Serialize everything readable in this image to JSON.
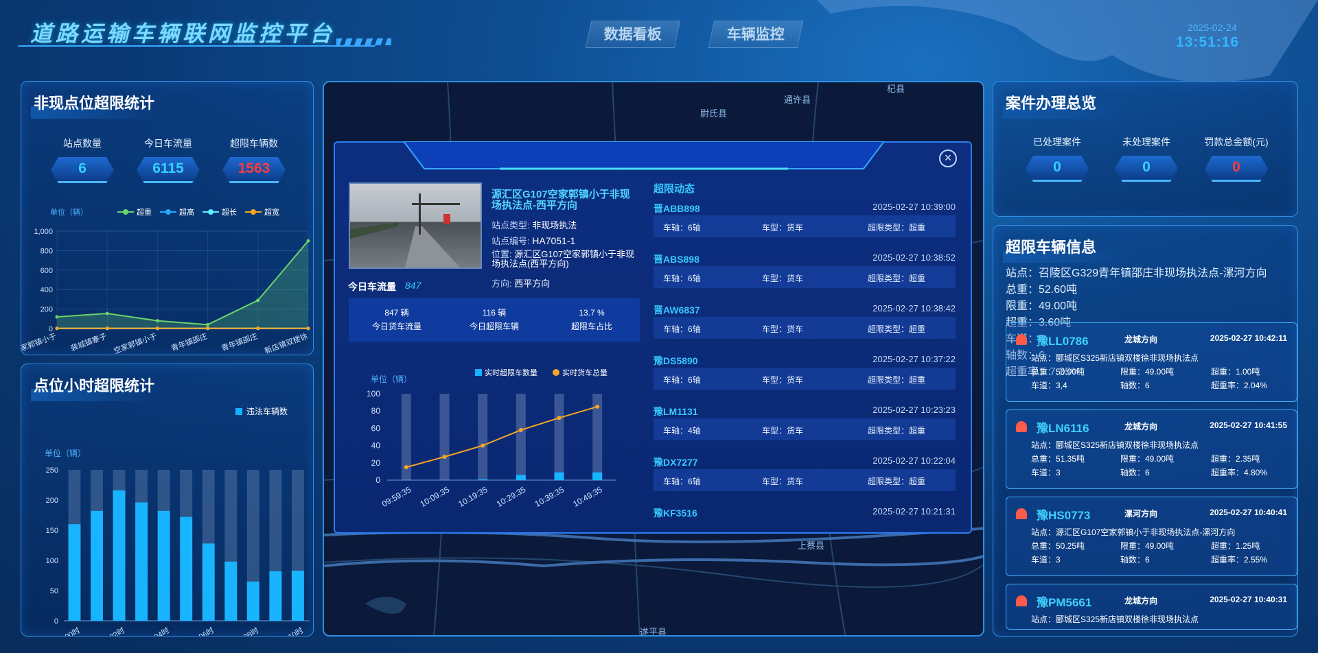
{
  "header": {
    "title": "道路运输车辆联网监控平台",
    "nav": [
      "数据看板",
      "车辆监控"
    ],
    "date": "2025-02-24",
    "time": "13:51:16"
  },
  "left_top": {
    "title": "非现点位超限统计",
    "stats": [
      {
        "label": "站点数量",
        "value": "6"
      },
      {
        "label": "今日车流量",
        "value": "6115"
      },
      {
        "label": "超限车辆数",
        "value": "1563"
      }
    ],
    "chart_data": {
      "type": "line",
      "unit": "单位（辆）",
      "categories": [
        "空家郭镇小于",
        "裴城镇寨子",
        "空家郭镇小于",
        "青年镇邵庄",
        "青年镇邵庄",
        "新店镇双楼徐"
      ],
      "ylim": [
        0,
        1000
      ],
      "yticks": [
        "1,000",
        "800",
        "600",
        "400",
        "200",
        "0"
      ],
      "series": [
        {
          "name": "超重",
          "color": "#6bd46b",
          "values": [
            120,
            155,
            80,
            40,
            290,
            900
          ]
        },
        {
          "name": "超高",
          "color": "#26a7ff",
          "values": [
            2,
            2,
            2,
            2,
            2,
            2
          ]
        },
        {
          "name": "超长",
          "color": "#5ff0ff",
          "values": [
            1,
            1,
            1,
            1,
            1,
            1
          ]
        },
        {
          "name": "超宽",
          "color": "#f5a623",
          "values": [
            3,
            3,
            3,
            3,
            3,
            3
          ]
        }
      ]
    }
  },
  "left_bottom": {
    "title": "点位小时超限统计",
    "chart_data": {
      "type": "bar",
      "unit": "单位（辆）",
      "legend": "违法车辆数",
      "ylim": [
        0,
        250
      ],
      "yticks": [
        "250",
        "200",
        "150",
        "100",
        "50",
        "0"
      ],
      "categories": [
        "00时",
        "01时",
        "02时",
        "03时",
        "04时",
        "05时",
        "06时",
        "07时",
        "08时",
        "09时",
        "10时"
      ],
      "xticks_shown": [
        "00时",
        "02时",
        "04时",
        "06时",
        "08时",
        "10时"
      ],
      "values": [
        160,
        182,
        216,
        196,
        182,
        172,
        128,
        98,
        65,
        82,
        83
      ]
    }
  },
  "popup": {
    "close": "×",
    "site_name": "源汇区G107空家郭镇小于非现场执法点-西平方向",
    "site_type_label": "站点类型:",
    "site_type": "非现场执法",
    "site_code_label": "站点编号:",
    "site_code": "HA7051-1",
    "location_label": "位置:",
    "location": "源汇区G107空家郭镇小于非现场执法点(西平方向)",
    "direction_label": "方向:",
    "direction": "西平方向",
    "flow_label": "今日车流量",
    "flow_value": "847",
    "summary": [
      {
        "value": "847 辆",
        "label": "今日货车流量"
      },
      {
        "value": "116 辆",
        "label": "今日超限车辆"
      },
      {
        "value": "13.7 %",
        "label": "超限车占比"
      }
    ],
    "chart_data": {
      "type": "bar+line",
      "unit": "单位（辆）",
      "legend": [
        "实时超限车数量",
        "实时货车总量"
      ],
      "ylim": [
        0,
        100
      ],
      "yticks": [
        "100",
        "80",
        "60",
        "40",
        "20",
        "0"
      ],
      "categories": [
        "09:59:35",
        "10:04:35",
        "10:09:35",
        "10:14:35",
        "10:19:35",
        "10:24:35",
        "10:29:35",
        "10:34:35",
        "10:39:35",
        "10:44:35",
        "10:49:35"
      ],
      "xticks_shown": [
        "09:59:35",
        "10:09:35",
        "10:19:35",
        "10:29:35",
        "10:39:35",
        "10:49:35"
      ],
      "bars": [
        0,
        0,
        1,
        6,
        9,
        9
      ],
      "line": [
        15,
        27,
        40,
        58,
        72,
        85
      ]
    },
    "alarm_title": "超限动态",
    "alarms": [
      {
        "plate": "晋ABB898",
        "time": "2025-02-27 10:39:00",
        "axle": "车轴：6轴",
        "type": "车型：货车",
        "over": "超限类型：超重"
      },
      {
        "plate": "晋ABS898",
        "time": "2025-02-27 10:38:52",
        "axle": "车轴：6轴",
        "type": "车型：货车",
        "over": "超限类型：超重"
      },
      {
        "plate": "晋AW6837",
        "time": "2025-02-27 10:38:42",
        "axle": "车轴：6轴",
        "type": "车型：货车",
        "over": "超限类型：超重"
      },
      {
        "plate": "豫DS5890",
        "time": "2025-02-27 10:37:22",
        "axle": "车轴：6轴",
        "type": "车型：货车",
        "over": "超限类型：超重"
      },
      {
        "plate": "豫LM1131",
        "time": "2025-02-27 10:23:23",
        "axle": "车轴：4轴",
        "type": "车型：货车",
        "over": "超限类型：超重"
      },
      {
        "plate": "豫DX7277",
        "time": "2025-02-27 10:22:04",
        "axle": "车轴：6轴",
        "type": "车型：货车",
        "over": "超限类型：超重"
      },
      {
        "plate": "豫KF3516",
        "time": "2025-02-27 10:21:31",
        "axle": "",
        "type": "",
        "over": ""
      }
    ]
  },
  "map_labels": [
    "杞县",
    "通许县",
    "尉氏县",
    "上蔡县",
    "遂平县"
  ],
  "right_top": {
    "title": "案件办理总览",
    "stats": [
      {
        "label": "已处理案件",
        "value": "0"
      },
      {
        "label": "未处理案件",
        "value": "0"
      },
      {
        "label": "罚款总金额(元)",
        "value": "0"
      }
    ]
  },
  "right_bottom": {
    "title": "超限车辆信息",
    "partial": {
      "site": "站点：召陵区G329青年镇邵庄非现场执法点-漯河方向",
      "total": "总重：52.60吨",
      "limit": "限重：49.00吨",
      "over": "超重：3.60吨",
      "lane": "车道：5",
      "axles": "轴数：6",
      "rate": "超重率：7.35%"
    },
    "cards": [
      {
        "plate": "豫LL0786",
        "dir": "龙城方向",
        "time": "2025-02-27 10:42:11",
        "site": "站点：郾城区S325新店镇双楼徐非现场执法点",
        "total": "总重：50.00吨",
        "limit": "限重：49.00吨",
        "over": "超重：1.00吨",
        "lane": "车道：3,4",
        "axles": "轴数：6",
        "rate": "超重率：2.04%"
      },
      {
        "plate": "豫LN6116",
        "dir": "龙城方向",
        "time": "2025-02-27 10:41:55",
        "site": "站点：郾城区S325新店镇双楼徐非现场执法点",
        "total": "总重：51.35吨",
        "limit": "限重：49.00吨",
        "over": "超重：2.35吨",
        "lane": "车道：3",
        "axles": "轴数：6",
        "rate": "超重率：4.80%"
      },
      {
        "plate": "豫HS0773",
        "dir": "漯河方向",
        "time": "2025-02-27 10:40:41",
        "site": "站点：源汇区G107空家郭镇小于非现场执法点-漯河方向",
        "total": "总重：50.25吨",
        "limit": "限重：49.00吨",
        "over": "超重：1.25吨",
        "lane": "车道：3",
        "axles": "轴数：6",
        "rate": "超重率：2.55%"
      },
      {
        "plate": "豫PM5661",
        "dir": "龙城方向",
        "time": "2025-02-27 10:40:31",
        "site": "站点：郾城区S325新店镇双楼徐非现场执法点",
        "total": "",
        "limit": "",
        "over": "",
        "lane": "",
        "axles": "",
        "rate": ""
      }
    ]
  }
}
